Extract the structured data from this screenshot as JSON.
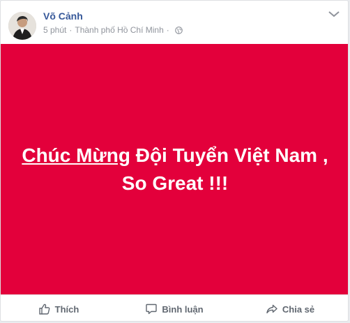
{
  "post": {
    "author": "Võ Cảnh",
    "time": "5 phút",
    "separator": "·",
    "location": "Thành phố Hồ Chí Minh",
    "privacy_icon": "globe-icon",
    "more_icon": "more-options-icon"
  },
  "banner": {
    "background": "#e3003b",
    "text_link": "Chúc Mừng",
    "text_rest": " Đội Tuyển Việt Nam , So Great !!!"
  },
  "actions": {
    "like_label": "Thích",
    "comment_label": "Bình luận",
    "share_label": "Chia sẻ"
  },
  "colors": {
    "author_link": "#365899",
    "meta_text": "#90949c",
    "action_text": "#606770"
  }
}
